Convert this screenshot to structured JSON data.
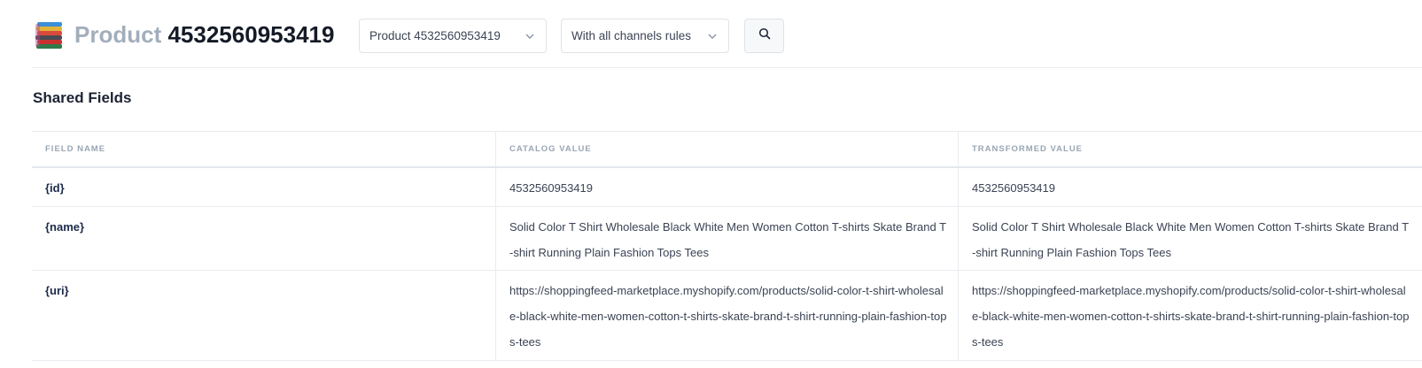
{
  "header": {
    "title_prefix": "Product",
    "title_id": "4532560953419",
    "product_select": {
      "value": "Product 4532560953419"
    },
    "rules_select": {
      "value": "With all channels rules"
    },
    "search_button": {
      "icon": "search-icon"
    },
    "logo_icon": "stacked-tshirts-icon"
  },
  "section": {
    "title": "Shared Fields"
  },
  "table": {
    "columns": [
      "FIELD NAME",
      "CATALOG VALUE",
      "TRANSFORMED VALUE"
    ],
    "rows": [
      {
        "field": "{id}",
        "catalog": "4532560953419",
        "transformed": "4532560953419"
      },
      {
        "field": "{name}",
        "catalog": "Solid Color T Shirt Wholesale Black White Men Women Cotton T-shirts Skate Brand T-shirt Running Plain Fashion Tops Tees",
        "transformed": "Solid Color T Shirt Wholesale Black White Men Women Cotton T-shirts Skate Brand T-shirt Running Plain Fashion Tops Tees"
      },
      {
        "field": "{uri}",
        "catalog": "https://shoppingfeed-marketplace.myshopify.com/products/solid-color-t-shirt-wholesale-black-white-men-women-cotton-t-shirts-skate-brand-t-shirt-running-plain-fashion-tops-tees",
        "transformed": "https://shoppingfeed-marketplace.myshopify.com/products/solid-color-t-shirt-wholesale-black-white-men-women-cotton-t-shirts-skate-brand-t-shirt-running-plain-fashion-tops-tees"
      }
    ]
  },
  "colors": {
    "title_muted": "#a2aebb",
    "text": "#1c2333",
    "border": "#e9ecf0",
    "header_label": "#9aa6b4"
  }
}
